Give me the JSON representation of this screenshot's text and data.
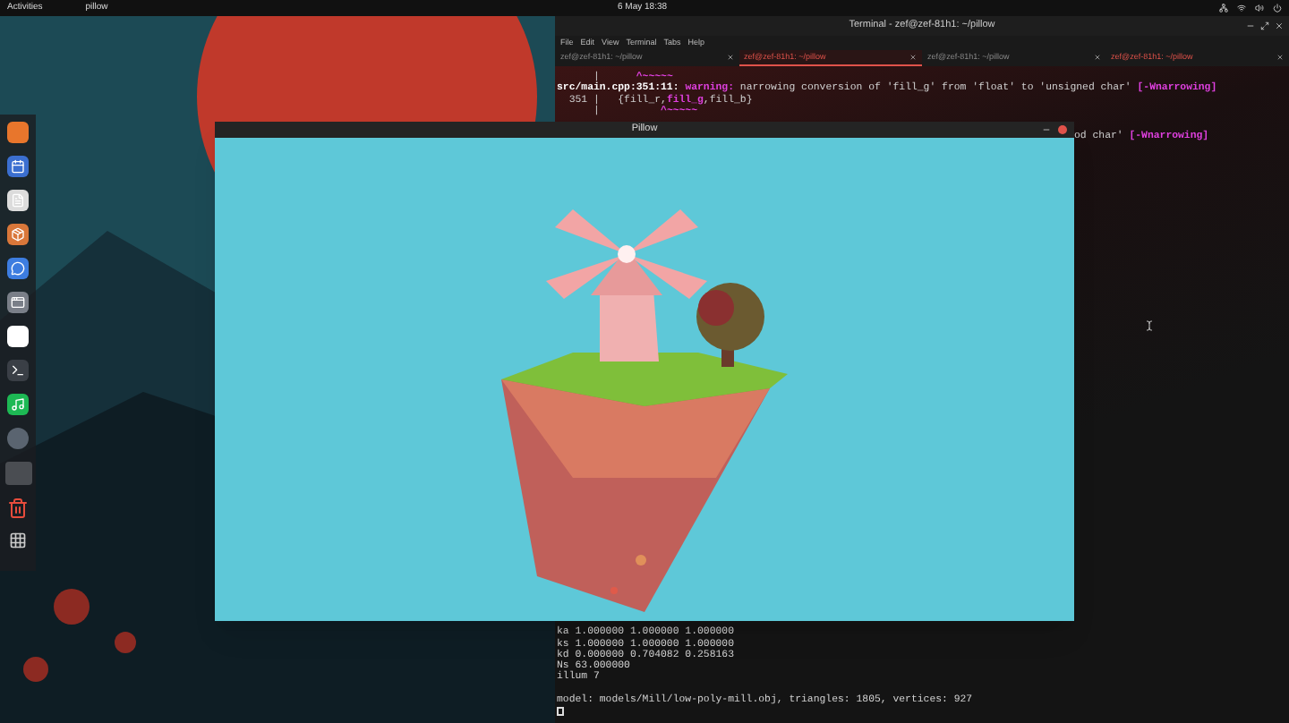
{
  "top_bar": {
    "activities": "Activities",
    "app_name": "pillow",
    "clock": "6 May  18:38"
  },
  "terminal": {
    "title": "Terminal - zef@zef-81h1: ~/pillow",
    "menu": [
      "File",
      "Edit",
      "View",
      "Terminal",
      "Tabs",
      "Help"
    ],
    "tabs": [
      {
        "label": "zef@zef-81h1: ~/pillow",
        "selected": false,
        "activity": false
      },
      {
        "label": "zef@zef-81h1: ~/pillow",
        "selected": true,
        "activity": true
      },
      {
        "label": "zef@zef-81h1: ~/pillow",
        "selected": false,
        "activity": false
      },
      {
        "label": "zef@zef-81h1: ~/pillow",
        "selected": false,
        "activity": true
      }
    ],
    "lines_top": [
      [
        {
          "text": "      |      ",
          "kind": "plain"
        },
        {
          "text": "^~~~~~",
          "kind": "warn"
        }
      ],
      [
        {
          "text": "src/main.cpp:351:11: ",
          "kind": "bold"
        },
        {
          "text": "warning:",
          "kind": "warn"
        },
        {
          "text": " narrowing conversion of 'fill_g' from 'float' to 'unsigned char' ",
          "kind": "plain"
        },
        {
          "text": "[-Wnarrowing]",
          "kind": "warn"
        }
      ],
      [
        {
          "text": "  351 |   {fill_r,",
          "kind": "plain"
        },
        {
          "text": "fill_g",
          "kind": "warn"
        },
        {
          "text": ",fill_b}",
          "kind": "plain"
        }
      ],
      [
        {
          "text": "      |          ",
          "kind": "plain"
        },
        {
          "text": "^~~~~~",
          "kind": "warn"
        }
      ]
    ],
    "partial_line": [
      {
        "text": "od char' ",
        "kind": "plain"
      },
      {
        "text": "[-Wnarrowing]",
        "kind": "warn"
      }
    ],
    "lines_bottom": [
      [
        {
          "text": "ka 1.000000 1.000000 1.000000",
          "kind": "plain"
        }
      ],
      [
        {
          "text": "ks 1.000000 1.000000 1.000000",
          "kind": "plain"
        }
      ],
      [
        {
          "text": "kd 0.000000 0.704082 0.258163",
          "kind": "plain"
        }
      ],
      [
        {
          "text": "Ns 63.000000",
          "kind": "plain"
        }
      ],
      [
        {
          "text": "illum 7",
          "kind": "plain"
        }
      ]
    ],
    "model_line": [
      {
        "text": "model: models/Mill/low-poly-mill.obj, triangles: 1805, vertices: 927",
        "kind": "plain"
      }
    ]
  },
  "pillow_window": {
    "title": "Pillow"
  }
}
